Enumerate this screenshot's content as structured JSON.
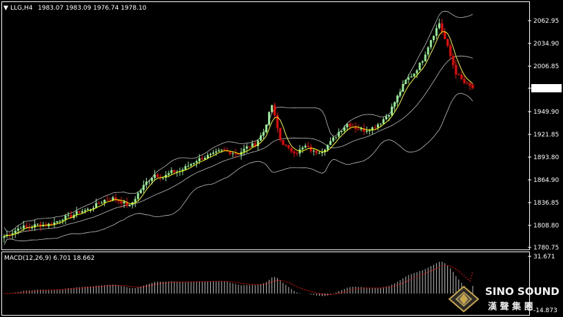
{
  "header": {
    "symbol": "LLG,H4",
    "ohlc": "1983.07 1983.09 1976.74 1978.10"
  },
  "macd_header": {
    "label": "MACD(12,26,9) 6.701 18.662"
  },
  "watermark": {
    "brand": "SINO SOUND",
    "brand_cn": "漢 聲 集 團",
    "logo": "diamond-logo-icon"
  },
  "colors": {
    "bull": "#90ee90",
    "bear": "#ff0000",
    "ma_fast": "#ffff00",
    "bands": "#c0c0c0",
    "macd_hist": "#c0c0c0",
    "macd_signal": "#ff0000",
    "axis": "#ffffff"
  },
  "chart_data": [
    {
      "type": "candlestick",
      "title": "LLG,H4",
      "ylim": [
        1780.75,
        2070
      ],
      "y_ticks": [
        "2062.95",
        "2034.90",
        "2006.85",
        "1978.10",
        "1949.90",
        "1921.85",
        "1893.80",
        "1864.90",
        "1836.85",
        "1808.80",
        "1780.75"
      ],
      "current_price": "1978.10",
      "last_bar": {
        "open": 1983.07,
        "high": 1983.09,
        "low": 1976.74,
        "close": 1978.1
      },
      "indicators": [
        "bollinger_bands",
        "moving_average"
      ],
      "close_anchors": [
        1795,
        1800,
        1807,
        1806,
        1810,
        1809,
        1812,
        1818,
        1820,
        1826,
        1828,
        1834,
        1840,
        1842,
        1838,
        1832,
        1848,
        1862,
        1872,
        1868,
        1875,
        1876,
        1883,
        1890,
        1894,
        1897,
        1902,
        1900,
        1898,
        1906,
        1910,
        1925,
        1958,
        1915,
        1903,
        1900,
        1907,
        1900,
        1902,
        1912,
        1925,
        1935,
        1930,
        1927,
        1930,
        1937,
        1948,
        1968,
        1988,
        1998,
        2015,
        2040,
        2060,
        2030,
        1998,
        1985,
        1978.1
      ]
    },
    {
      "type": "macd",
      "title": "MACD(12,26,9)",
      "params": [
        12,
        26,
        9
      ],
      "macd_value": 6.701,
      "signal_value": 18.662,
      "ylim": [
        -14.873,
        31.671
      ],
      "y_ticks": [
        "31.671",
        "-14.873"
      ]
    }
  ]
}
